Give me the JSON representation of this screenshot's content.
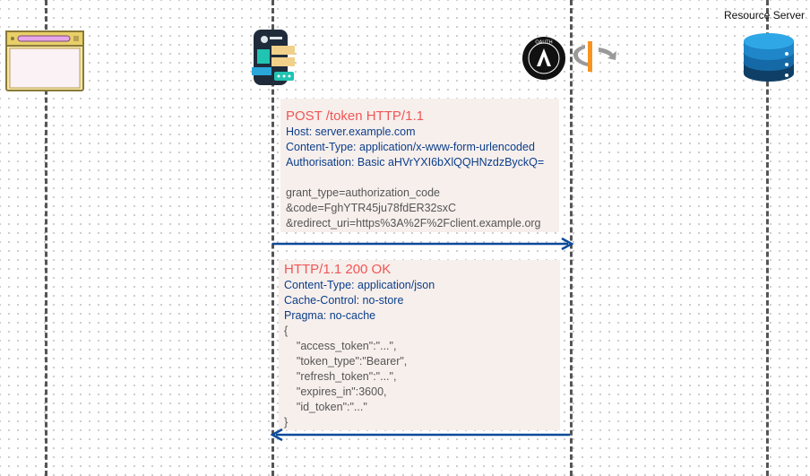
{
  "participants": {
    "resource_server_label": "Resource Server",
    "auth_logo_text": "OAUTH"
  },
  "request": {
    "title": "POST /token HTTP/1.1",
    "headers": [
      "Host: server.example.com",
      "Content-Type: application/x-www-form-urlencoded",
      "Authorisation: Basic aHVrYXI6bXlQQHNzdzByckQ="
    ],
    "body": [
      "grant_type=authorization_code",
      "&code=FghYTR45ju78fdER32sxC",
      "&redirect_uri=https%3A%2F%2Fclient.example.org"
    ]
  },
  "response": {
    "title": "HTTP/1.1 200 OK",
    "headers": [
      "Content-Type: application/json",
      "Cache-Control: no-store",
      "Pragma: no-cache"
    ],
    "body": [
      "{",
      "    \"access_token\":\"...\",",
      "    \"token_type\":\"Bearer\",",
      "    \"refresh_token\":\"...\",",
      "    \"expires_in\":3600,",
      "    \"id_token\":\"...\"",
      "}"
    ]
  },
  "colors": {
    "lifeline": "#555555",
    "arrow": "#0b4a9a",
    "title": "#f05656",
    "header": "#0b3e8a",
    "body": "#555555",
    "box": "#f7efec"
  }
}
